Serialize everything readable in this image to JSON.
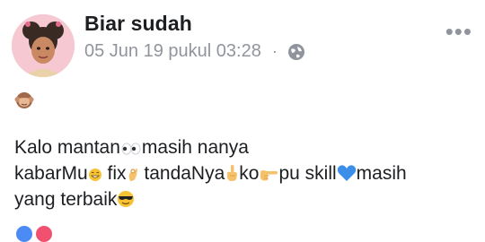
{
  "post": {
    "author_name": "Biar sudah",
    "timestamp": "05 Jun 19 pukul 03:28",
    "separator": "·",
    "privacy_icon": "globe-icon",
    "more_icon": "more-options-icon",
    "more_label": "•••"
  },
  "content": {
    "first_emoji": "monkey-face-icon",
    "segments": {
      "line1_a": "Kalo mantan",
      "line1_b": "masih nanya",
      "line2_a": "kabarMu",
      "line2_b": " fix",
      "line2_c": " tandaNya",
      "line2_d": "ko",
      "line2_e": "pu skill",
      "line2_f": "masih",
      "line3_a": "yang terbaik"
    },
    "emojis": [
      "eyes-icon",
      "grin-icon",
      "ok-hand-icon",
      "pointing-up-icon",
      "pointing-right-icon",
      "blue-heart-icon",
      "sunglasses-face-icon"
    ]
  },
  "colors": {
    "author": "#1c1e21",
    "meta": "#90949c",
    "heart": "#3b8fe8"
  }
}
